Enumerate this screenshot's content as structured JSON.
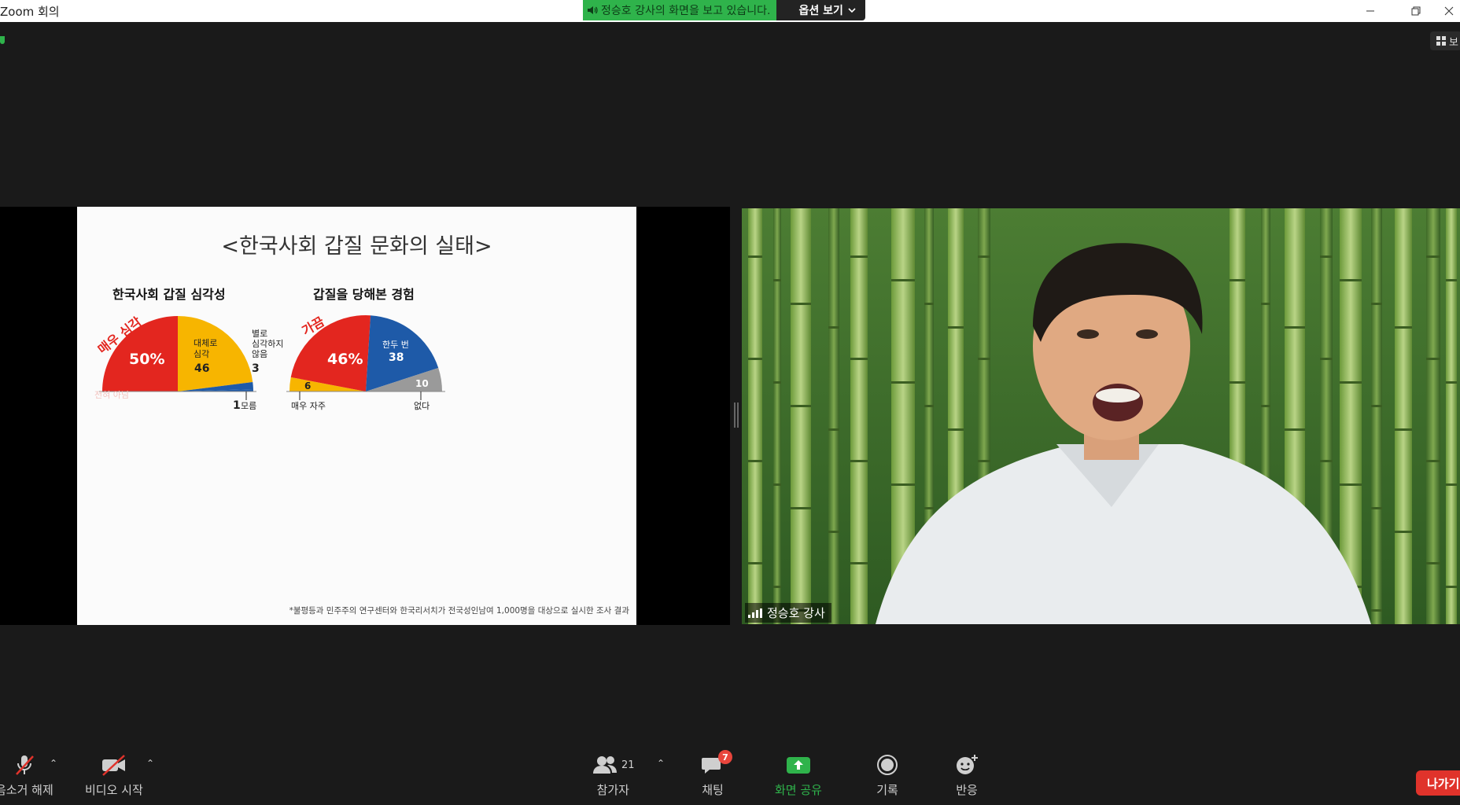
{
  "window": {
    "title": "Zoom 회의",
    "minimize_icon": "minimize-icon",
    "restore_icon": "restore-icon",
    "close_icon": "close-icon"
  },
  "share_banner": {
    "message": "정승호 강사의 화면을 보고 있습니다.",
    "options_label": "옵션 보기",
    "accent": "#2fb34b"
  },
  "view_chip": {
    "label": "보"
  },
  "slide": {
    "title": "<한국사회 갑질 문화의 실태>",
    "footnote": "*불평등과 민주주의 연구센터와 한국리서치가 전국성인남여 1,000명을 대상으로 실시한 조사 결과"
  },
  "chart_data": [
    {
      "type": "pie",
      "title": "한국사회 갑질 심각성",
      "slices": [
        {
          "label": "매우 심각",
          "value": 50,
          "display": "50%",
          "color": "#e3261f"
        },
        {
          "label": "대체로 심각",
          "value": 46,
          "display": "46",
          "color": "#f7b500"
        },
        {
          "label": "별로 심각하지 않음",
          "value": 3,
          "display": "3",
          "color": "#1e5aa8"
        },
        {
          "label": "모름",
          "value": 1,
          "display": "1",
          "color": "#1e5aa8"
        }
      ],
      "labels": {
        "arc_label": "매우 심각",
        "mid_label_line1": "대체로",
        "mid_label_line2": "심각",
        "side_line1": "별로",
        "side_line2": "심각하지",
        "side_line3": "않음",
        "bottom_label": "모름",
        "hidden_label": "전혀 아님"
      }
    },
    {
      "type": "pie",
      "title": "갑질을 당해본 경험",
      "slices": [
        {
          "label": "매우 자주",
          "value": 6,
          "display": "6",
          "color": "#f7b500"
        },
        {
          "label": "가끔",
          "value": 46,
          "display": "46%",
          "color": "#e3261f"
        },
        {
          "label": "한두 번",
          "value": 38,
          "display": "38",
          "color": "#1e5aa8"
        },
        {
          "label": "없다",
          "value": 10,
          "display": "10",
          "color": "#9a9a9a"
        }
      ],
      "labels": {
        "arc_label": "가끔",
        "bottom_left": "매우 자주",
        "bottom_right": "없다"
      }
    }
  ],
  "video": {
    "participant_name": "정승호 강사"
  },
  "toolbar": {
    "unmute_label": "음소거 해제",
    "video_label": "비디오 시작",
    "participants_label": "참가자",
    "participants_count": "21",
    "chat_label": "채팅",
    "chat_badge": "7",
    "share_label": "화면 공유",
    "record_label": "기록",
    "reactions_label": "반응",
    "leave_label": "나가기",
    "caret": "⌃"
  }
}
